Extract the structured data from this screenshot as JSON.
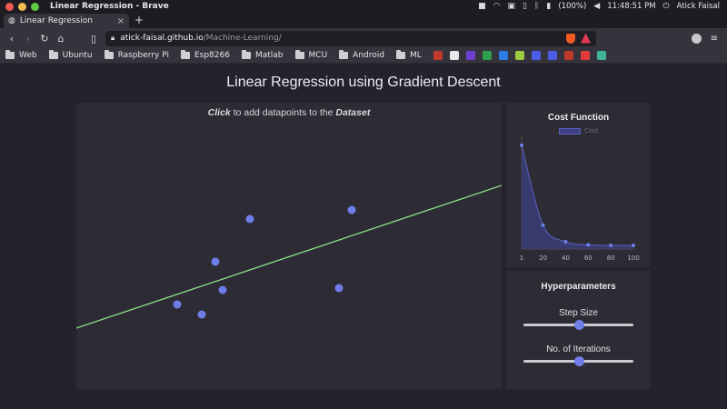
{
  "os_bar": {
    "window_title": "Linear Regression - Brave",
    "battery": "(100%)",
    "clock": "11:48:51 PM",
    "user": "Atick Faisal"
  },
  "browser": {
    "tab_title": "Linear Regression",
    "url_host": "atick-faisal.github.io",
    "url_path": "/Machine-Learning/",
    "bookmarks": [
      "Web",
      "Ubuntu",
      "Raspberry Pi",
      "Esp8266",
      "Matlab",
      "MCU",
      "Android",
      "ML"
    ],
    "favicon_colors": [
      "#c0392b",
      "#e8e8e8",
      "#6c3fd1",
      "#2e9e4f",
      "#2b7de9",
      "#9ccc3d",
      "#4b5de6",
      "#4b5de6",
      "#c0392b",
      "#e23b3b",
      "#3fb59b"
    ]
  },
  "page": {
    "title": "Linear Regression using Gradient Descent",
    "hint_click": "Click",
    "hint_middle": " to add datapoints to the ",
    "hint_dataset": "Dataset"
  },
  "dataset": {
    "points": [
      [
        275,
        241
      ],
      [
        387,
        231
      ],
      [
        237,
        288
      ],
      [
        245,
        319
      ],
      [
        373,
        317
      ],
      [
        195,
        335
      ],
      [
        222,
        346
      ]
    ],
    "point_color": "#6f7de8",
    "line_color": "#8ee08a"
  },
  "cost_panel": {
    "title": "Cost Function"
  },
  "chart_data": {
    "type": "area",
    "title": "",
    "legend": [
      "Cost"
    ],
    "x": [
      1,
      20,
      40,
      60,
      80,
      100
    ],
    "xticks": [
      "1",
      "20",
      "40",
      "60",
      "80",
      "100"
    ],
    "series": [
      {
        "name": "Cost",
        "values": [
          1.0,
          0.23,
          0.07,
          0.04,
          0.035,
          0.035
        ]
      }
    ],
    "ylim": [
      0,
      1.05
    ],
    "grid": false,
    "color": "#5a63c2"
  },
  "hyper_panel": {
    "title": "Hyperparameters",
    "step_size_label": "Step Size",
    "step_size_value": 0.5,
    "iterations_label": "No. of Iterations",
    "iterations_value": 0.5
  }
}
